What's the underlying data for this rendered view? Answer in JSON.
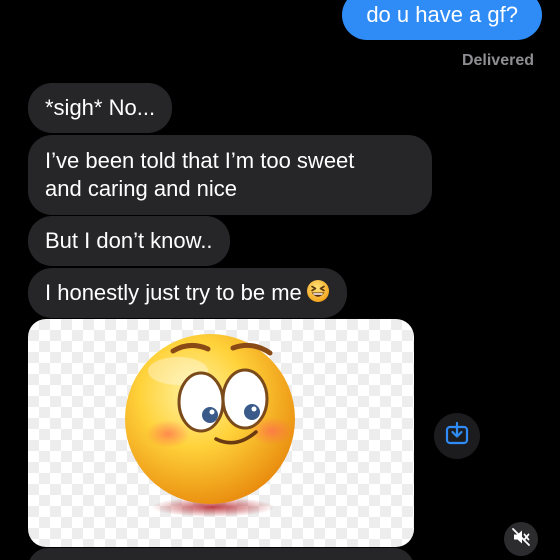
{
  "conversation": {
    "outgoing": [
      {
        "text": "do u have a gf?"
      }
    ],
    "status": "Delivered",
    "incoming": [
      {
        "lines": [
          "*sigh* No..."
        ]
      },
      {
        "lines": [
          "I’ve been told that I’m too sweet",
          "and caring and nice"
        ]
      },
      {
        "lines": [
          "But I don’t know.."
        ]
      },
      {
        "lines": [
          "I honestly just try to be me"
        ],
        "emoji": "grinning-squinting-face"
      }
    ],
    "attachment": {
      "type": "image",
      "subject": "blushing-emoji-sticker"
    }
  },
  "controls": {
    "save_icon": "save-to-photos-icon",
    "mute_icon": "speaker-muted-icon"
  },
  "colors": {
    "background": "#000000",
    "outgoing_bubble": "#2f8cf7",
    "incoming_bubble": "#262628",
    "status_text": "#8e8e93",
    "accent": "#2f8cf7"
  }
}
